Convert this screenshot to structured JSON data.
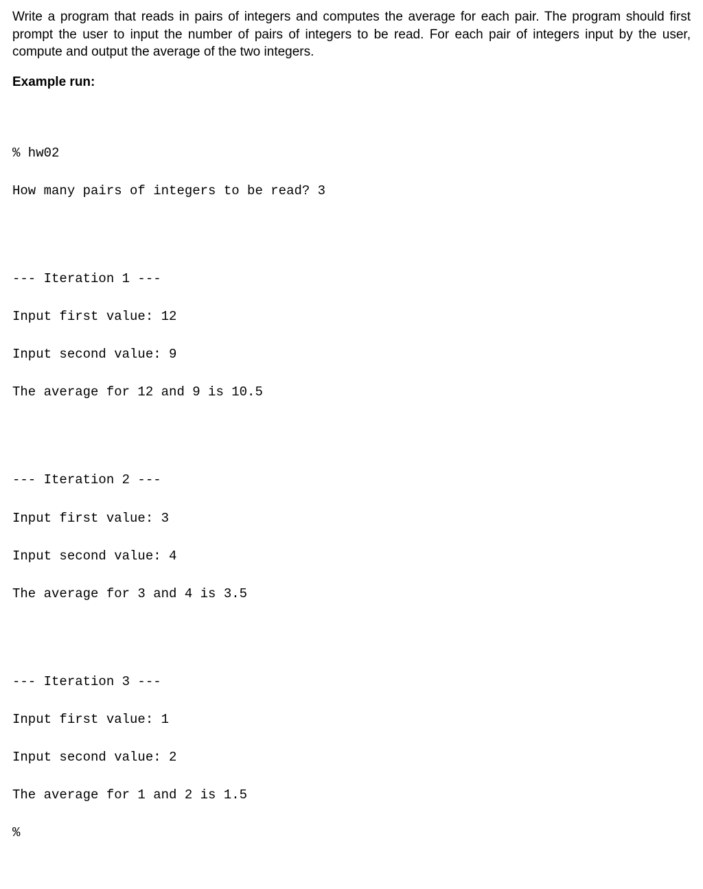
{
  "instructions": "Write a program that reads in pairs of integers and computes the average for each pair. The program should first prompt the user to input the number of pairs of integers to be read. For each pair of integers input by the user, compute and output the average of the two integers.",
  "example_heading": "Example run:",
  "terminal": {
    "cmd": "% hw02",
    "prompt_pairs": "How many pairs of integers to be read? 3",
    "iterations": [
      {
        "header": "--- Iteration 1 ---",
        "first": "Input first value: 12",
        "second": "Input second value: 9",
        "avg": "The average for 12 and 9 is 10.5"
      },
      {
        "header": "--- Iteration 2 ---",
        "first": "Input first value: 3",
        "second": "Input second value: 4",
        "avg": "The average for 3 and 4 is 3.5"
      },
      {
        "header": "--- Iteration 3 ---",
        "first": "Input first value: 1",
        "second": "Input second value: 2",
        "avg": "The average for 1 and 2 is 1.5"
      }
    ],
    "end_prompt": "%"
  }
}
